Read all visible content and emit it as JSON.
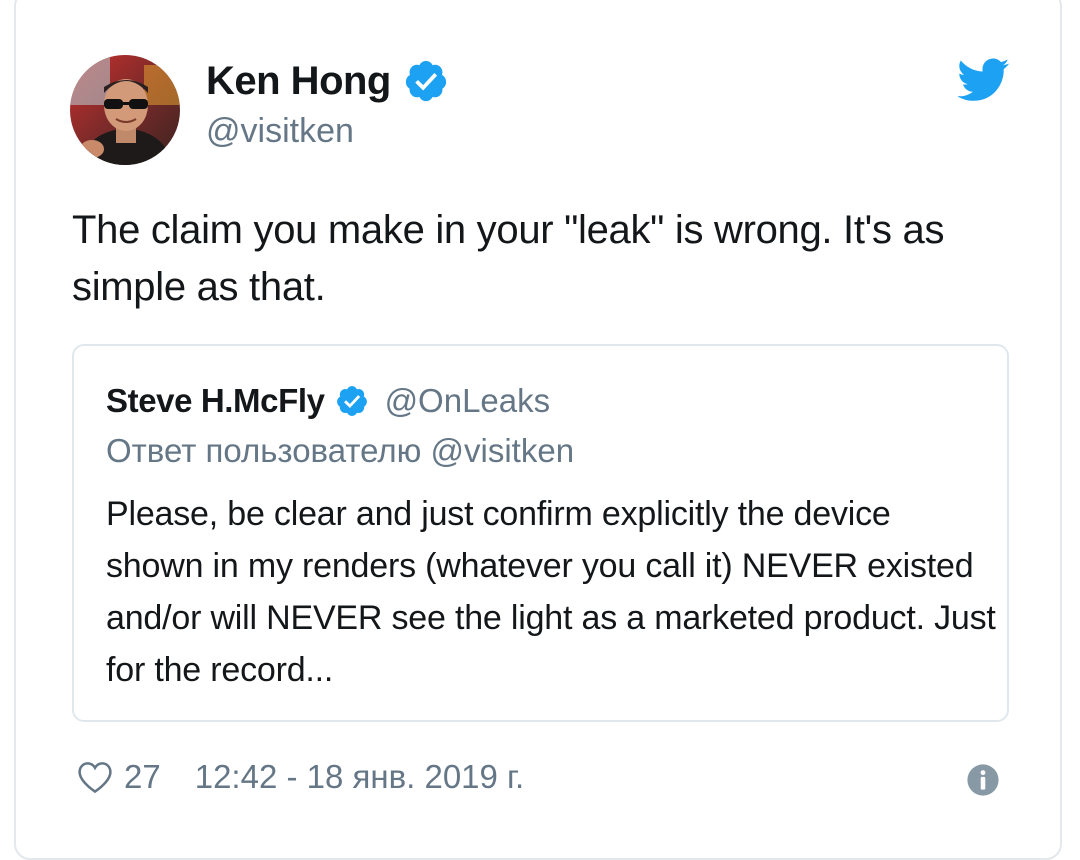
{
  "author": {
    "name": "Ken Hong",
    "handle": "@visitken",
    "verified": true
  },
  "tweet": {
    "text": "The claim you make in your \"leak\" is wrong. It's as simple as that."
  },
  "quoted_tweet": {
    "name": "Steve H.McFly",
    "handle": "@OnLeaks",
    "verified": true,
    "reply_to": "Ответ пользователю @visitken",
    "text": "Please, be clear and just confirm explicitly the device shown in my renders (whatever you call it) NEVER existed and/or will NEVER see the light as a marketed product. Just for the record..."
  },
  "footer": {
    "likes": "27",
    "timestamp": "12:42 - 18 янв. 2019 г."
  },
  "icons": {
    "bird": "twitter-bird-icon",
    "verified": "verified-badge-icon",
    "heart": "heart-icon",
    "info": "info-icon"
  },
  "colors": {
    "accent": "#1da1f2",
    "text": "#14171a",
    "muted": "#657786",
    "border": "#e1e8ed"
  }
}
